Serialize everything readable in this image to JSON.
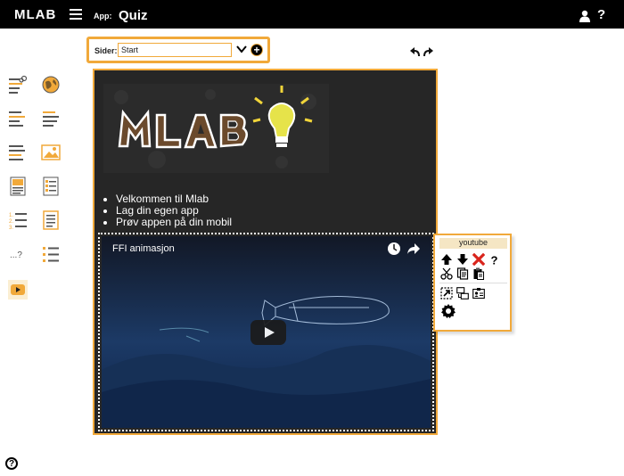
{
  "header": {
    "brand": "MLAB",
    "app_label": "App:",
    "app_name": "Quiz",
    "help": "?"
  },
  "page_selector": {
    "label": "Sider:",
    "value": "Start"
  },
  "toolbar": {
    "items": [
      "add-text-link-icon",
      "globe-icon",
      "align-left-icon",
      "align-center-icon",
      "text-block-icon",
      "image-icon",
      "image-text-document-icon",
      "checklist-document-icon",
      "numbered-list-icon",
      "document-icon",
      "quiz-question-icon",
      "bullet-list-icon",
      "youtube-icon"
    ]
  },
  "content": {
    "bullets": [
      "Velkommen til Mlab",
      "Lag din egen app",
      "Prøv appen på din mobil"
    ],
    "video_title": "FFI animasjon"
  },
  "popup": {
    "title": "youtube",
    "actions": [
      "move-up-icon",
      "move-down-icon",
      "delete-icon",
      "help-icon",
      "cut-icon",
      "copy-icon",
      "paste-icon",
      "resize-icon",
      "swap-icon",
      "info-card-icon",
      "settings-icon"
    ]
  },
  "colors": {
    "accent": "#f1a93a",
    "header_bg": "#000000",
    "panel_bg": "#262626"
  }
}
